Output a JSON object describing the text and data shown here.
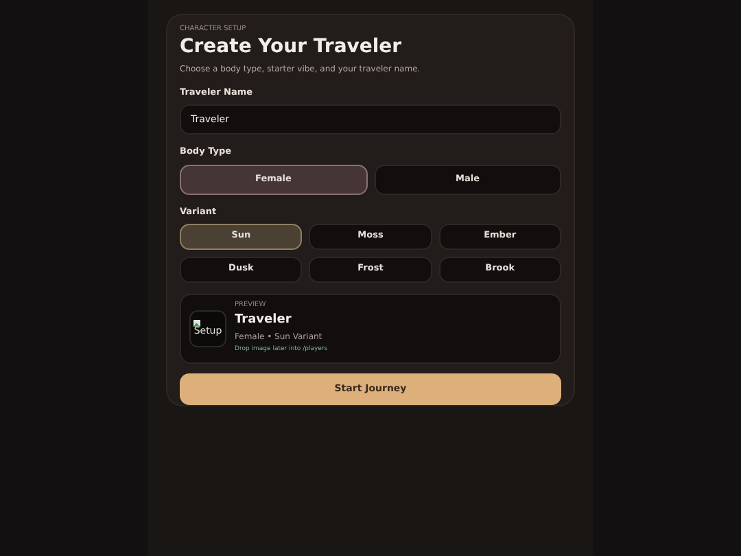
{
  "header": {
    "eyebrow": "CHARACTER SETUP",
    "title": "Create Your Traveler",
    "subtitle": "Choose a body type, starter vibe, and your traveler name."
  },
  "name_field": {
    "label": "Traveler Name",
    "value": "Traveler"
  },
  "body_type": {
    "label": "Body Type",
    "options": [
      {
        "label": "Female",
        "selected": true
      },
      {
        "label": "Male",
        "selected": false
      }
    ]
  },
  "variant": {
    "label": "Variant",
    "options": [
      {
        "label": "Sun",
        "selected": true
      },
      {
        "label": "Moss",
        "selected": false
      },
      {
        "label": "Ember",
        "selected": false
      },
      {
        "label": "Dusk",
        "selected": false
      },
      {
        "label": "Frost",
        "selected": false
      },
      {
        "label": "Brook",
        "selected": false
      }
    ]
  },
  "preview": {
    "eyebrow": "PREVIEW",
    "image_alt": "Setup",
    "name": "Traveler",
    "description": "Female • Sun Variant",
    "hint": "Drop image later into /players"
  },
  "start_button": "Start Journey"
}
